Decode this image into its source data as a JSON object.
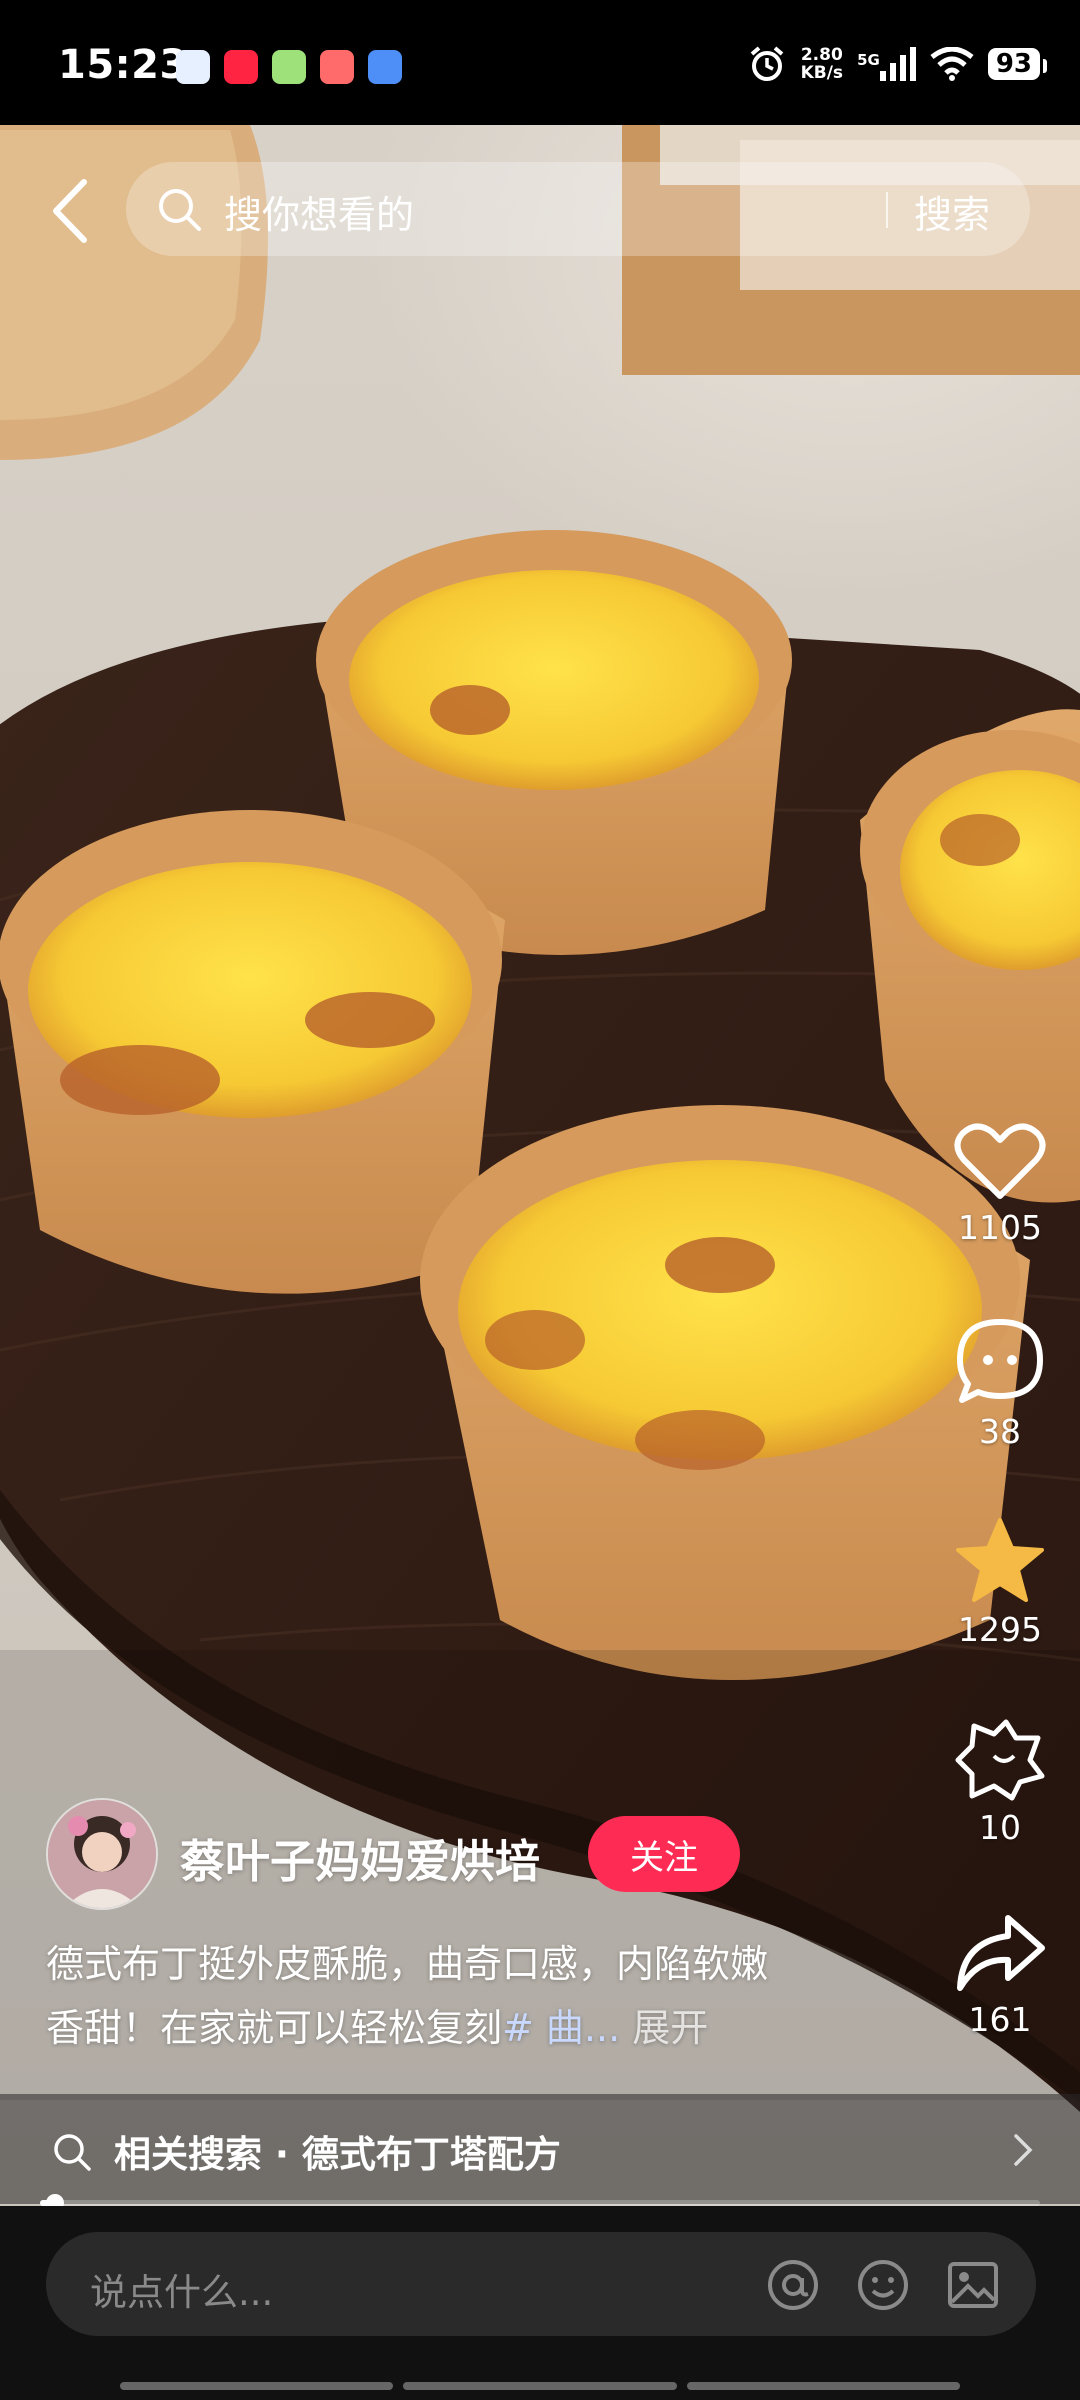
{
  "status_bar": {
    "time": "15:23",
    "net_speed_value": "2.80",
    "net_speed_unit": "KB/s",
    "network_generation": "5G",
    "battery": "93",
    "app_icons": [
      "app-icon-blue",
      "xiaohongshu-icon",
      "app-icon-green",
      "app-icon-red",
      "app-icon-lightblue"
    ]
  },
  "search": {
    "placeholder": "搜你想看的",
    "button_label": "搜索"
  },
  "actions": {
    "likes": "1105",
    "comments": "38",
    "favorites": "1295",
    "gifts": "10",
    "shares": "161"
  },
  "author": {
    "name": "蔡叶子妈妈爱烘培",
    "follow_label": "关注"
  },
  "caption": {
    "line1": "德式布丁挺外皮酥脆，曲奇口感，内陷软嫩",
    "line2_text": "香甜！在家就可以轻松复刻",
    "line2_tag": "# 曲...",
    "expand_label": "展开"
  },
  "related_search": {
    "text": "相关搜索 · 德式布丁塔配方"
  },
  "progress": {
    "fraction": 0.015
  },
  "comment_bar": {
    "placeholder": "说点什么..."
  },
  "colors": {
    "follow_button": "#fe2c55",
    "favorite_star": "#f5b945",
    "status_bar_bg": "#000000"
  }
}
